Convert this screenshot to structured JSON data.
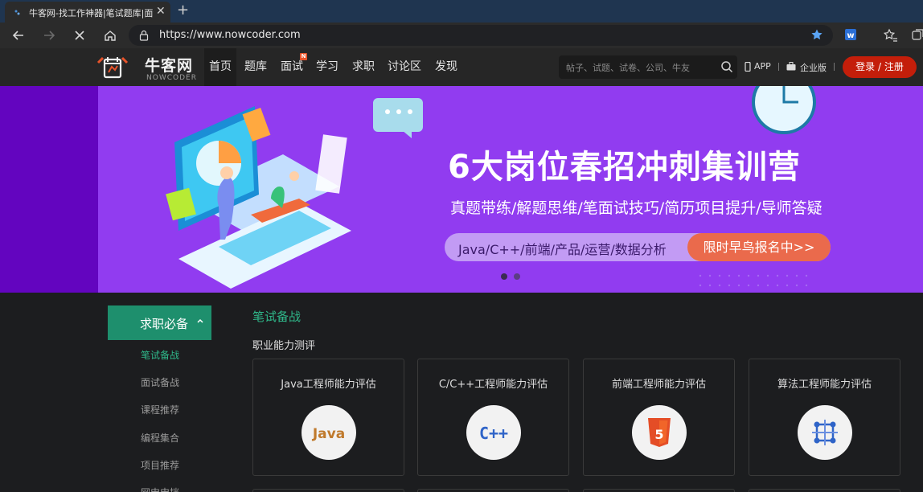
{
  "browser": {
    "tab_title": "牛客网-找工作神器|笔试题库|面试",
    "url": "https://www.nowcoder.com"
  },
  "header": {
    "logo_cn": "牛客网",
    "logo_en": "NOWCODER",
    "nav": [
      "首页",
      "题库",
      "面试",
      "学习",
      "求职",
      "讨论区",
      "发现"
    ],
    "nav_badge": "N",
    "search_placeholder": "帖子、试题、试卷、公司、牛友",
    "app_label": "APP",
    "enterprise_label": "企业版",
    "login_label": "登录 / 注册"
  },
  "banner": {
    "title": "6大岗位春招冲刺集训营",
    "subtitle": "真题带练/解题思维/笔面试技巧/简历项目提升/导师答疑",
    "pill_left": "Java/C++/前端/产品/运营/数据分析",
    "pill_right": "限时早鸟报名中>>",
    "slide_count": 2,
    "active_slide": 0
  },
  "sidebar": {
    "title": "求职必备",
    "items": [
      "笔试备战",
      "面试备战",
      "课程推荐",
      "编程集合",
      "项目推荐",
      "网申申挡"
    ],
    "active_index": 0
  },
  "main": {
    "section_title": "笔试备战",
    "section_subtitle": "职业能力测评",
    "cards": [
      {
        "title": "Java工程师能力评估",
        "icon": "java-icon",
        "icon_text": "Java"
      },
      {
        "title": "C/C++工程师能力评估",
        "icon": "cpp-icon",
        "icon_text": "C++"
      },
      {
        "title": "前端工程师能力评估",
        "icon": "html5-icon",
        "icon_text": "5"
      },
      {
        "title": "算法工程师能力评估",
        "icon": "algorithm-icon",
        "icon_text": ""
      }
    ]
  },
  "colors": {
    "accent_green": "#1e8f6d",
    "banner_purple": "#913cf0",
    "login_red": "#c41e0a"
  }
}
